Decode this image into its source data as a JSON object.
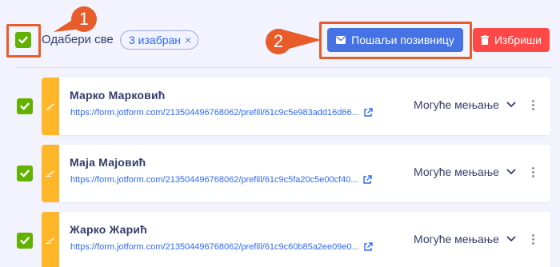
{
  "toolbar": {
    "select_all_label": "Одабери све",
    "selected_chip": "3 изабран",
    "chip_close": "×",
    "send_invite_label": "Пошаљи позивницу",
    "delete_label": "Избриши"
  },
  "callouts": [
    {
      "number": "1"
    },
    {
      "number": "2"
    }
  ],
  "rows": [
    {
      "name": "Марко Марковић",
      "link": "https://form.jotform.com/213504496768062/prefill/61c9c5e983add16d66...",
      "permission": "Могуће мењање"
    },
    {
      "name": "Маја Мајовић",
      "link": "https://form.jotform.com/213504496768062/prefill/61c9c5fa20c5e00cf40...",
      "permission": "Могуће мењање"
    },
    {
      "name": "Жарко Жарић",
      "link": "https://form.jotform.com/213504496768062/prefill/61c9c60b85a2ee09e0...",
      "permission": "Могуће мењање"
    }
  ],
  "colors": {
    "background": "#f3f3fe",
    "checkbox": "#64b200",
    "accent_bar": "#ffb629",
    "primary_button": "#4573e3",
    "danger_button": "#ff4948",
    "callout": "#e85b2b",
    "link": "#2e69ff"
  },
  "icons": {
    "checkbox": "check-icon",
    "send": "envelope-icon",
    "delete": "trash-icon",
    "row_badge": "pen-icon",
    "open_link": "external-link-icon",
    "dropdown": "chevron-down-icon",
    "menu": "kebab-menu-icon"
  }
}
